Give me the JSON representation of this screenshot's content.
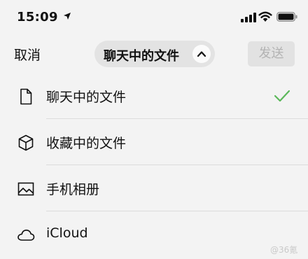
{
  "status_bar": {
    "time": "15:09",
    "icons": [
      "location-arrow-icon",
      "signal-bars-icon",
      "wifi-icon",
      "battery-icon"
    ]
  },
  "header": {
    "cancel_label": "取消",
    "title": "聊天中的文件",
    "title_icon": "chevron-up-icon",
    "send_label": "发送"
  },
  "file_sources": [
    {
      "label": "聊天中的文件",
      "icon": "document-icon",
      "selected": true
    },
    {
      "label": "收藏中的文件",
      "icon": "cube-icon",
      "selected": false
    },
    {
      "label": "手机相册",
      "icon": "photo-icon",
      "selected": false
    },
    {
      "label": "iCloud",
      "icon": "cloud-icon",
      "selected": false
    }
  ],
  "watermark": "@36氪",
  "colors": {
    "check_accent": "#5bb85a",
    "background": "#f3f3f3",
    "pill_background": "#e3e3e3",
    "send_disabled_text": "#b3b3b3"
  }
}
